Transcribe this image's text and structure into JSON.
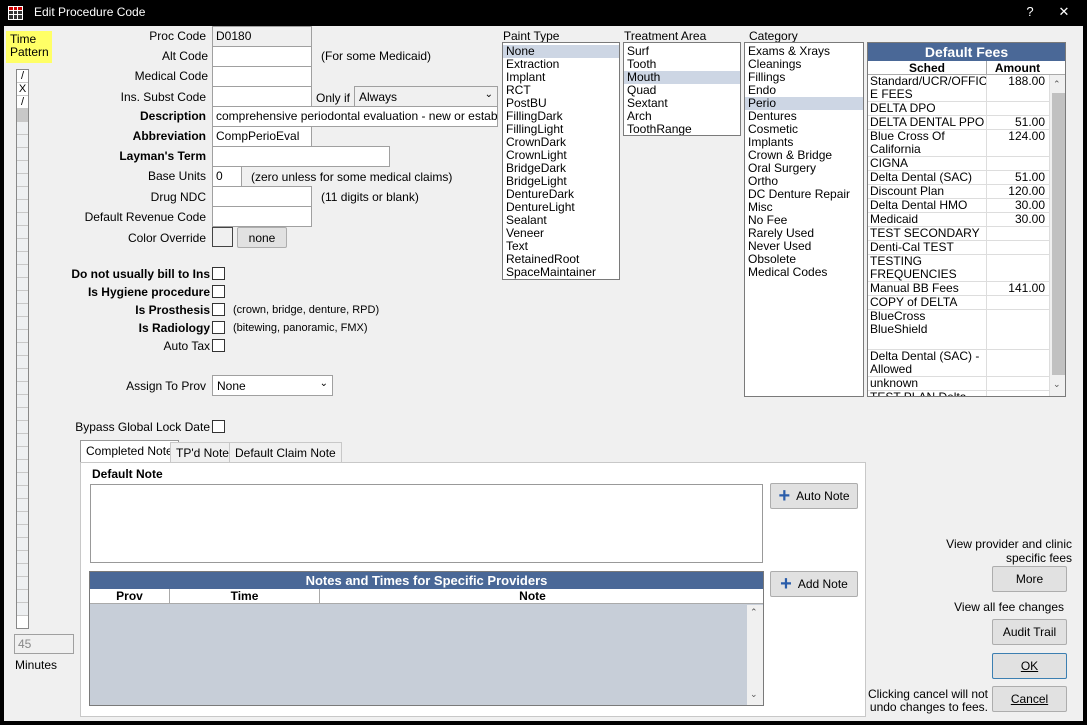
{
  "window": {
    "title": "Edit Procedure Code",
    "help_label": "?",
    "close_label": "✕"
  },
  "time_pattern": {
    "label": "Time\nPattern",
    "cells": [
      "/",
      "X",
      "/"
    ],
    "minutes_value": "45",
    "minutes_label": "Minutes"
  },
  "fields": {
    "proc_code": {
      "label": "Proc Code",
      "value": "D0180"
    },
    "alt_code": {
      "label": "Alt Code",
      "value": "",
      "hint": "(For some Medicaid)"
    },
    "medical_code": {
      "label": "Medical Code",
      "value": ""
    },
    "ins_subst_code": {
      "label": "Ins. Subst Code",
      "value": "",
      "only_if_label": "Only if",
      "only_if_value": "Always"
    },
    "description": {
      "label": "Description",
      "value": "comprehensive periodontal evaluation - new or established p"
    },
    "abbreviation": {
      "label": "Abbreviation",
      "value": "CompPerioEval"
    },
    "laymans_term": {
      "label": "Layman's Term",
      "value": ""
    },
    "base_units": {
      "label": "Base Units",
      "value": "0",
      "hint": "(zero unless for some medical claims)"
    },
    "drug_ndc": {
      "label": "Drug NDC",
      "value": "",
      "hint": "(11 digits or blank)"
    },
    "default_revenue_code": {
      "label": "Default Revenue Code",
      "value": ""
    },
    "color_override": {
      "label": "Color Override",
      "button": "none"
    }
  },
  "checks": {
    "no_bill_ins": {
      "label": "Do not usually bill to Ins"
    },
    "hygiene": {
      "label": "Is Hygiene procedure"
    },
    "prosthesis": {
      "label": "Is Prosthesis",
      "hint": "(crown, bridge, denture, RPD)"
    },
    "radiology": {
      "label": "Is Radiology",
      "hint": "(bitewing, panoramic, FMX)"
    },
    "auto_tax": {
      "label": "Auto Tax"
    },
    "bypass_lock": {
      "label": "Bypass Global Lock Date"
    }
  },
  "assign_to_prov": {
    "label": "Assign To Prov",
    "value": "None"
  },
  "paint_type": {
    "label": "Paint Type",
    "selected": "None",
    "items": [
      "None",
      "Extraction",
      "Implant",
      "RCT",
      "PostBU",
      "FillingDark",
      "FillingLight",
      "CrownDark",
      "CrownLight",
      "BridgeDark",
      "BridgeLight",
      "DentureDark",
      "DentureLight",
      "Sealant",
      "Veneer",
      "Text",
      "RetainedRoot",
      "SpaceMaintainer"
    ]
  },
  "treatment_area": {
    "label": "Treatment Area",
    "selected": "Mouth",
    "items": [
      "Surf",
      "Tooth",
      "Mouth",
      "Quad",
      "Sextant",
      "Arch",
      "ToothRange"
    ]
  },
  "category": {
    "label": "Category",
    "selected": "Perio",
    "items": [
      "Exams & Xrays",
      "Cleanings",
      "Fillings",
      "Endo",
      "Perio",
      "Dentures",
      "Cosmetic",
      "Implants",
      "Crown & Bridge",
      "Oral Surgery",
      "Ortho",
      "DC Denture Repair",
      "Misc",
      "No Fee",
      "Rarely Used",
      "Never Used",
      "Obsolete",
      "Medical Codes"
    ]
  },
  "default_fees": {
    "title": "Default Fees",
    "col_sched": "Sched",
    "col_amount": "Amount",
    "rows": [
      {
        "sched": "Standard/UCR/OFFIC\nE FEES",
        "amount": "188.00",
        "lines": 2
      },
      {
        "sched": "DELTA DPO",
        "amount": "",
        "lines": 1
      },
      {
        "sched": "DELTA DENTAL PPO",
        "amount": "51.00",
        "lines": 1
      },
      {
        "sched": "Blue Cross Of\nCalifornia",
        "amount": "124.00",
        "lines": 2
      },
      {
        "sched": "CIGNA",
        "amount": "",
        "lines": 1
      },
      {
        "sched": "Delta Dental (SAC)",
        "amount": "51.00",
        "lines": 1
      },
      {
        "sched": "Discount Plan",
        "amount": "120.00",
        "lines": 1
      },
      {
        "sched": "Delta Dental HMO",
        "amount": "30.00",
        "lines": 1
      },
      {
        "sched": "Medicaid",
        "amount": "30.00",
        "lines": 1
      },
      {
        "sched": "TEST SECONDARY",
        "amount": "",
        "lines": 1
      },
      {
        "sched": "Denti-Cal TEST",
        "amount": "",
        "lines": 1
      },
      {
        "sched": "TESTING\nFREQUENCIES",
        "amount": "",
        "lines": 2
      },
      {
        "sched": "Manual BB Fees",
        "amount": "141.00",
        "lines": 1
      },
      {
        "sched": "COPY of DELTA DPO",
        "amount": "",
        "lines": 1
      },
      {
        "sched": "BlueCross BlueShield",
        "amount": "",
        "lines": 3
      },
      {
        "sched": "Delta Dental (SAC) -\nAllowed",
        "amount": "",
        "lines": 2
      },
      {
        "sched": "unknown",
        "amount": "",
        "lines": 1
      },
      {
        "sched": "TEST PLAN Delta",
        "amount": "",
        "lines": 1
      }
    ]
  },
  "notes": {
    "tabs": [
      "Completed Note",
      "TP'd Note",
      "Default Claim Note"
    ],
    "default_note_label": "Default Note",
    "default_note_value": "",
    "auto_note_button": "Auto Note",
    "add_note_button": "Add Note",
    "providers_title": "Notes and Times for Specific Providers",
    "col_prov": "Prov",
    "col_time": "Time",
    "col_note": "Note"
  },
  "right_actions": {
    "view_provider_text": "View provider and clinic\nspecific fees",
    "more_button": "More",
    "view_fee_changes_text": "View all fee changes",
    "audit_trail_button": "Audit Trail",
    "ok_button": "OK",
    "cancel_note": "Clicking cancel will not\nundo changes to fees.",
    "cancel_button": "Cancel"
  },
  "colors": {
    "grid_header": "#4a6897",
    "selection": "#cdd6e4",
    "time_pattern_highlight": "#ffff66"
  }
}
